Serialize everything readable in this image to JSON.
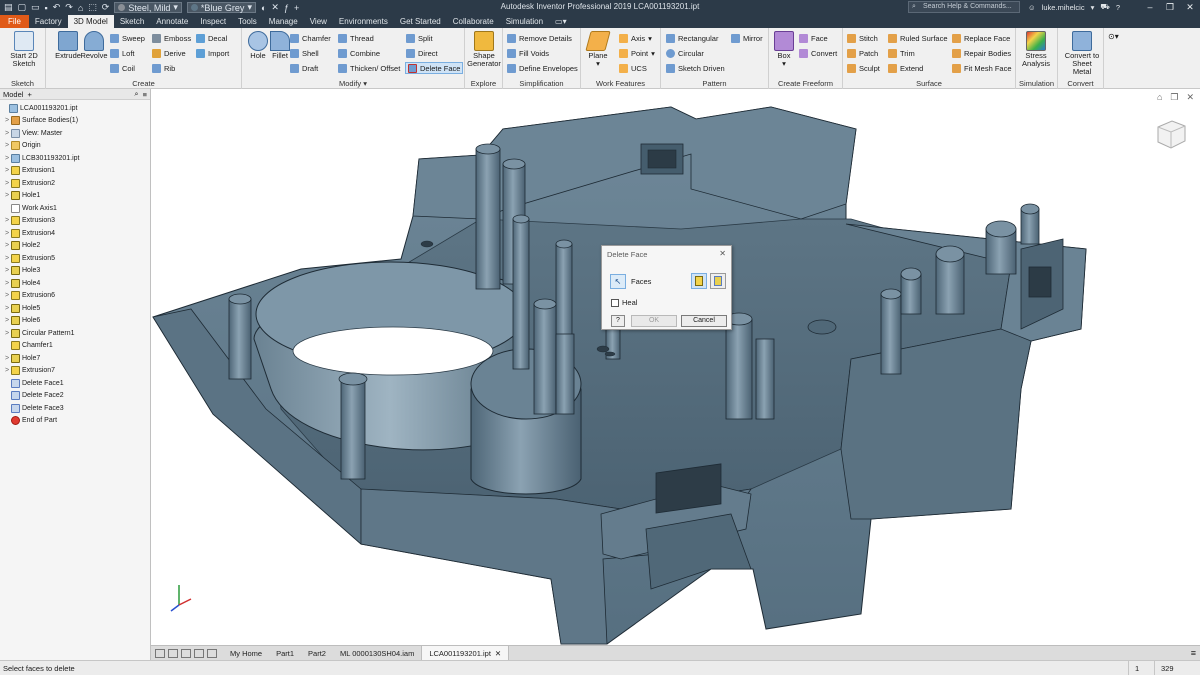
{
  "window": {
    "app_title": "Autodesk Inventor Professional 2019   LCA001193201.ipt",
    "material": "Steel, Mild",
    "appearance": "*Blue Grey",
    "search_placeholder": "Search Help & Commands...",
    "user": "luke.mihelcic",
    "colors": {
      "titlebar": "#2c3a48",
      "file_tab": "#e05a18",
      "model": "#5e7687"
    }
  },
  "ribbon_tabs": [
    "File",
    "Factory",
    "3D Model",
    "Sketch",
    "Annotate",
    "Inspect",
    "Tools",
    "Manage",
    "View",
    "Environments",
    "Get Started",
    "Collaborate",
    "Simulation"
  ],
  "active_tab": "3D Model",
  "panels": {
    "sketch": {
      "label": "Sketch",
      "start_sketch": "Start 2D Sketch"
    },
    "create": {
      "label": "Create",
      "extrude": "Extrude",
      "revolve": "Revolve",
      "sweep": "Sweep",
      "loft": "Loft",
      "coil": "Coil",
      "emboss": "Emboss",
      "derive": "Derive",
      "rib": "Rib",
      "decal": "Decal",
      "import": "Import"
    },
    "modify": {
      "label": "Modify",
      "hole": "Hole",
      "fillet": "Fillet",
      "chamfer": "Chamfer",
      "shell": "Shell",
      "draft": "Draft",
      "thread": "Thread",
      "combine": "Combine",
      "thicken": "Thicken/ Offset",
      "split": "Split",
      "direct": "Direct",
      "delete_face": "Delete Face"
    },
    "explore": {
      "label": "Explore",
      "shape_generator": "Shape Generator"
    },
    "simplification": {
      "label": "Simplification",
      "remove_details": "Remove Details",
      "fill_voids": "Fill Voids",
      "define_envelopes": "Define Envelopes"
    },
    "work_features": {
      "label": "Work Features",
      "plane": "Plane",
      "axis": "Axis",
      "point": "Point",
      "ucs": "UCS"
    },
    "pattern": {
      "label": "Pattern",
      "rectangular": "Rectangular",
      "circular": "Circular",
      "sketch_driven": "Sketch Driven",
      "mirror": "Mirror"
    },
    "create_freeform": {
      "label": "Create Freeform",
      "box": "Box",
      "face": "Face",
      "convert": "Convert"
    },
    "surface": {
      "label": "Surface",
      "stitch": "Stitch",
      "patch": "Patch",
      "sculpt": "Sculpt",
      "ruled_surface": "Ruled Surface",
      "trim": "Trim",
      "extend": "Extend",
      "replace_face": "Replace Face",
      "repair_bodies": "Repair Bodies",
      "fit_mesh_face": "Fit Mesh Face"
    },
    "simulation": {
      "label": "Simulation",
      "stress_analysis": "Stress Analysis"
    },
    "convert": {
      "label": "Convert",
      "convert_to_sheet_metal": "Convert to Sheet Metal"
    }
  },
  "browser": {
    "title": "Model",
    "tree": [
      {
        "label": "LCA001193201.ipt",
        "icon": "part",
        "exp": ""
      },
      {
        "label": "Surface Bodies(1)",
        "icon": "surf",
        "exp": ">"
      },
      {
        "label": "View: Master",
        "icon": "view",
        "exp": ">"
      },
      {
        "label": "Origin",
        "icon": "folder",
        "exp": ">"
      },
      {
        "label": "LCB301193201.ipt",
        "icon": "part",
        "exp": ">"
      },
      {
        "label": "Extrusion1",
        "icon": "feature",
        "exp": ">"
      },
      {
        "label": "Extrusion2",
        "icon": "feature",
        "exp": ">"
      },
      {
        "label": "Hole1",
        "icon": "hole",
        "exp": ">"
      },
      {
        "label": "Work Axis1",
        "icon": "axis",
        "exp": ""
      },
      {
        "label": "Extrusion3",
        "icon": "feature",
        "exp": ">"
      },
      {
        "label": "Extrusion4",
        "icon": "feature",
        "exp": ">"
      },
      {
        "label": "Hole2",
        "icon": "hole",
        "exp": ">"
      },
      {
        "label": "Extrusion5",
        "icon": "feature",
        "exp": ">"
      },
      {
        "label": "Hole3",
        "icon": "hole",
        "exp": ">"
      },
      {
        "label": "Hole4",
        "icon": "hole",
        "exp": ">"
      },
      {
        "label": "Extrusion6",
        "icon": "feature",
        "exp": ">"
      },
      {
        "label": "Hole5",
        "icon": "hole",
        "exp": ">"
      },
      {
        "label": "Hole6",
        "icon": "hole",
        "exp": ">"
      },
      {
        "label": "Circular Pattern1",
        "icon": "pattern",
        "exp": ">"
      },
      {
        "label": "Chamfer1",
        "icon": "feature",
        "exp": ""
      },
      {
        "label": "Hole7",
        "icon": "hole",
        "exp": ">"
      },
      {
        "label": "Extrusion7",
        "icon": "feature",
        "exp": ">"
      },
      {
        "label": "Delete Face1",
        "icon": "del",
        "exp": ""
      },
      {
        "label": "Delete Face2",
        "icon": "del",
        "exp": ""
      },
      {
        "label": "Delete Face3",
        "icon": "del",
        "exp": ""
      },
      {
        "label": "End of Part",
        "icon": "end",
        "exp": ""
      }
    ]
  },
  "dialog": {
    "title": "Delete Face",
    "faces_label": "Faces",
    "heal_label": "Heal",
    "heal_checked": false,
    "ok": "OK",
    "cancel": "Cancel"
  },
  "doc_tabs": [
    "My Home",
    "Part1",
    "Part2",
    "ML 0000130SH04.iam",
    "LCA001193201.ipt"
  ],
  "active_doc": "LCA001193201.ipt",
  "status": {
    "message": "Select faces to delete",
    "num1": "1",
    "num2": "329"
  }
}
